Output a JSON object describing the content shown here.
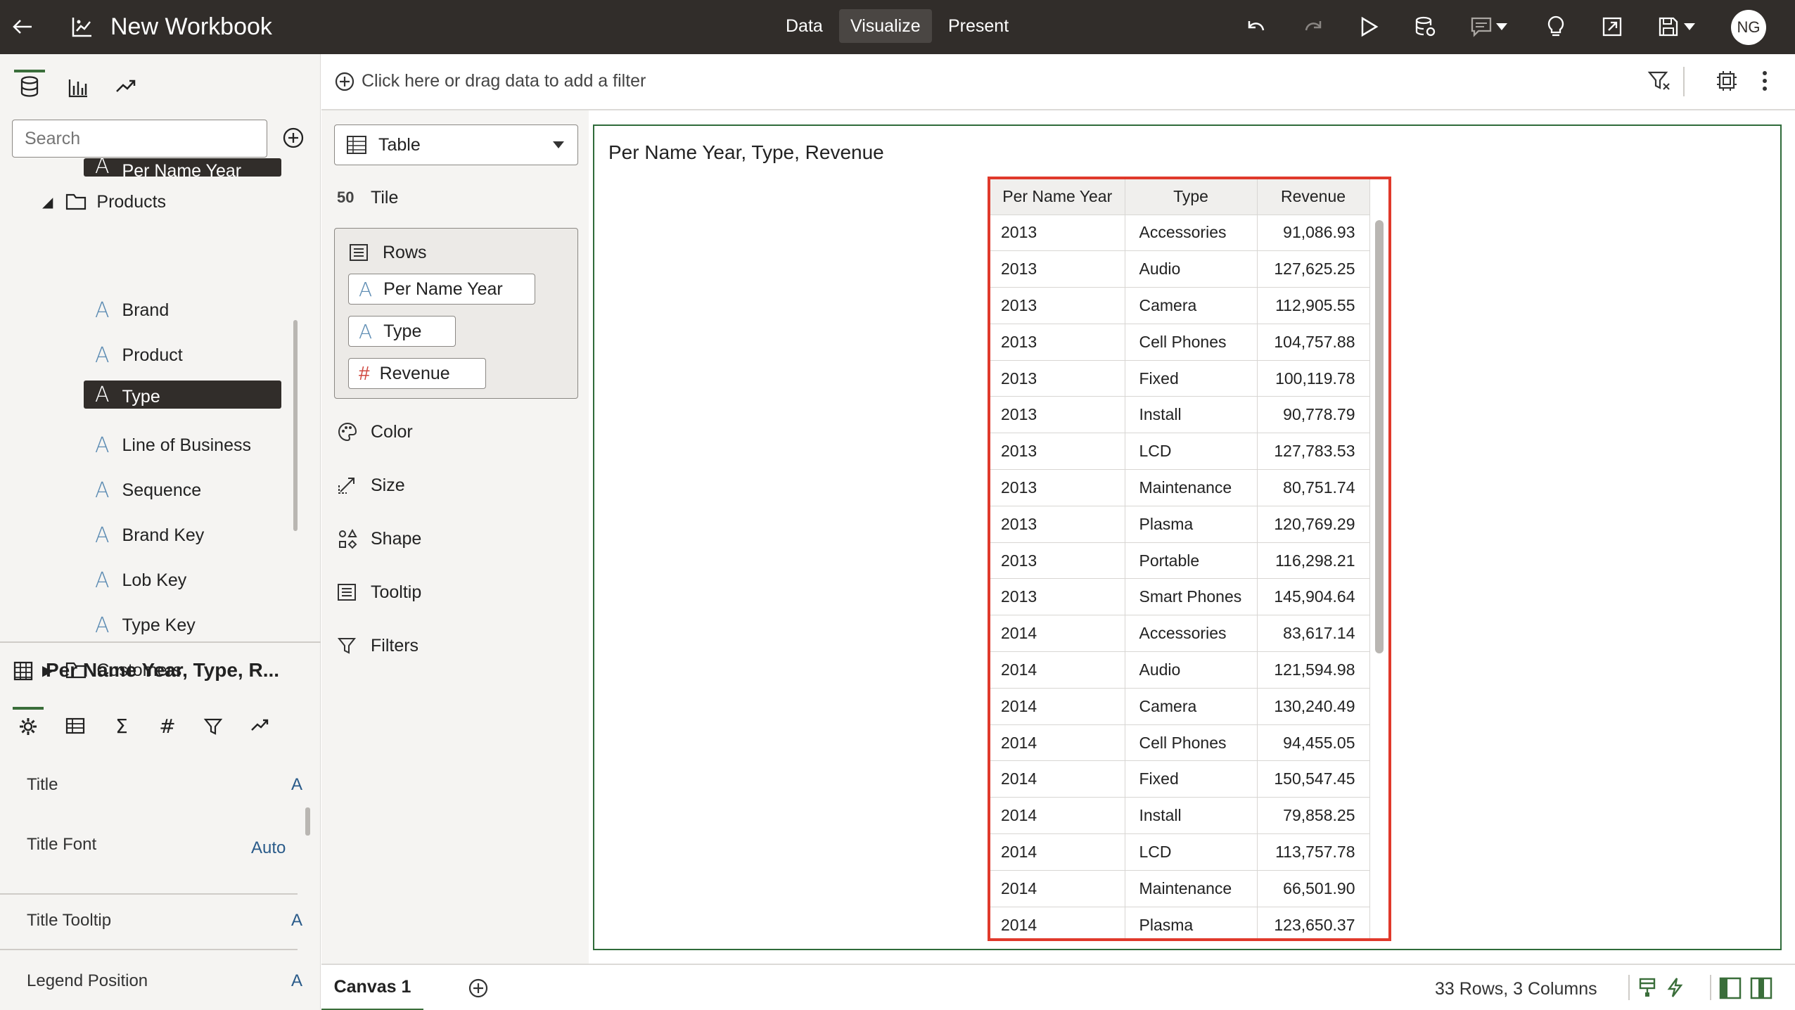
{
  "app": {
    "title": "New Workbook",
    "user_initials": "NG"
  },
  "modes": [
    "Data",
    "Visualize",
    "Present"
  ],
  "active_mode": "Visualize",
  "colors": {
    "topbar": "#312d2a",
    "accent_green": "#3a6e3a",
    "highlight_red": "#e0392b",
    "attribute_blue": "#5d8cb3",
    "measure_red": "#d0473f"
  },
  "data_panel": {
    "search_placeholder": "Search",
    "items": [
      {
        "kind": "attribute",
        "label": "Per Name Year",
        "selected": true
      },
      {
        "kind": "folder",
        "label": "Products",
        "expanded": true
      },
      {
        "kind": "attribute",
        "label": "Brand"
      },
      {
        "kind": "attribute",
        "label": "Product"
      },
      {
        "kind": "attribute",
        "label": "Type",
        "selected": true
      },
      {
        "kind": "attribute",
        "label": "Line of Business"
      },
      {
        "kind": "attribute",
        "label": "Sequence"
      },
      {
        "kind": "attribute",
        "label": "Brand Key"
      },
      {
        "kind": "attribute",
        "label": "Lob Key"
      },
      {
        "kind": "attribute",
        "label": "Type Key"
      },
      {
        "kind": "folder",
        "label": "Customers",
        "expanded": false
      }
    ]
  },
  "properties": {
    "viz_title": "Per Name Year, Type, R...",
    "rows": [
      {
        "label": "Title",
        "value": "A"
      },
      {
        "label": "Title Font",
        "value": "Auto"
      },
      {
        "label": "Title Tooltip",
        "value": "A"
      },
      {
        "label": "Legend Position",
        "value": "A"
      }
    ]
  },
  "filter_bar": {
    "text": "Click here or drag data to add a filter"
  },
  "grammar": {
    "viz_type": "Table",
    "tile": "Tile",
    "rows_label": "Rows",
    "row_pills": [
      {
        "kind": "attribute",
        "label": "Per Name Year"
      },
      {
        "kind": "attribute",
        "label": "Type"
      },
      {
        "kind": "measure",
        "label": "Revenue"
      }
    ],
    "sections": [
      "Color",
      "Size",
      "Shape",
      "Tooltip",
      "Filters"
    ]
  },
  "canvas": {
    "title": "Per Name Year, Type, Revenue",
    "table": {
      "columns": [
        "Per Name Year",
        "Type",
        "Revenue"
      ],
      "rows": [
        [
          "2013",
          "Accessories",
          "91,086.93"
        ],
        [
          "2013",
          "Audio",
          "127,625.25"
        ],
        [
          "2013",
          "Camera",
          "112,905.55"
        ],
        [
          "2013",
          "Cell Phones",
          "104,757.88"
        ],
        [
          "2013",
          "Fixed",
          "100,119.78"
        ],
        [
          "2013",
          "Install",
          "90,778.79"
        ],
        [
          "2013",
          "LCD",
          "127,783.53"
        ],
        [
          "2013",
          "Maintenance",
          "80,751.74"
        ],
        [
          "2013",
          "Plasma",
          "120,769.29"
        ],
        [
          "2013",
          "Portable",
          "116,298.21"
        ],
        [
          "2013",
          "Smart Phones",
          "145,904.64"
        ],
        [
          "2014",
          "Accessories",
          "83,617.14"
        ],
        [
          "2014",
          "Audio",
          "121,594.98"
        ],
        [
          "2014",
          "Camera",
          "130,240.49"
        ],
        [
          "2014",
          "Cell Phones",
          "94,455.05"
        ],
        [
          "2014",
          "Fixed",
          "150,547.45"
        ],
        [
          "2014",
          "Install",
          "79,858.25"
        ],
        [
          "2014",
          "LCD",
          "113,757.78"
        ],
        [
          "2014",
          "Maintenance",
          "66,501.90"
        ],
        [
          "2014",
          "Plasma",
          "123,650.37"
        ]
      ]
    }
  },
  "bottom": {
    "canvas_tab": "Canvas 1",
    "row_count": "33 Rows, 3 Columns"
  }
}
